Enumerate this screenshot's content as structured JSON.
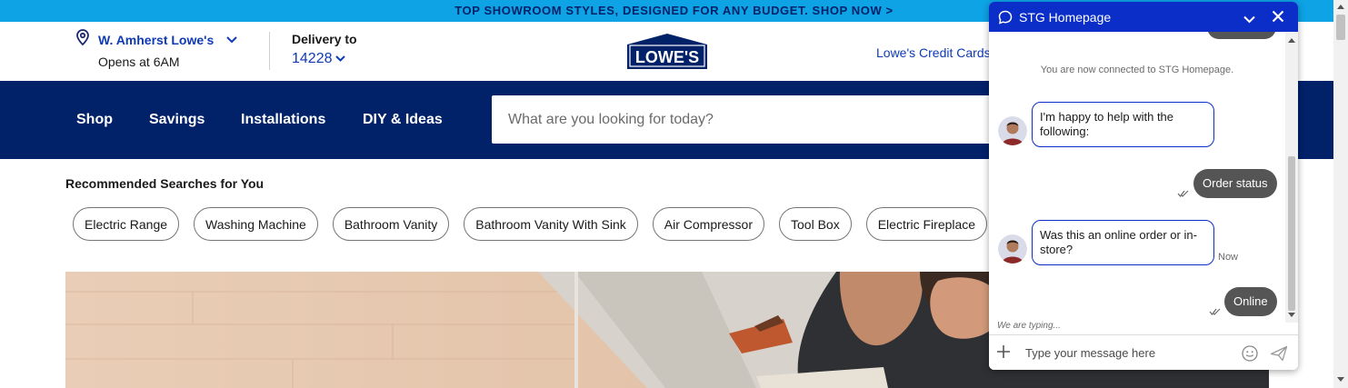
{
  "promo": {
    "text": "TOP SHOWROOM STYLES, DESIGNED FOR ANY BUDGET. SHOP NOW >"
  },
  "header": {
    "store_name": "W. Amherst Lowe's",
    "store_hours": "Opens at 6AM",
    "delivery_label": "Delivery to",
    "zip": "14228",
    "logo_text": "LOWE'S",
    "credit_link": "Lowe's Credit Cards"
  },
  "nav": {
    "items": [
      "Shop",
      "Savings",
      "Installations",
      "DIY & Ideas"
    ],
    "search_placeholder": "What are you looking for today?"
  },
  "recommended": {
    "title": "Recommended Searches for You",
    "chips": [
      "Electric Range",
      "Washing Machine",
      "Bathroom Vanity",
      "Bathroom Vanity With Sink",
      "Air Compressor",
      "Tool Box",
      "Electric Fireplace"
    ]
  },
  "chat": {
    "title": "STG Homepage",
    "system_message": "You are now connected to STG Homepage.",
    "messages": {
      "agent_1": "I'm happy to help with the following:",
      "user_1": "Order status",
      "agent_2": "Was this an online order or in-store?",
      "agent_2_time": "Now",
      "user_2": "Online"
    },
    "typing": "We are typing...",
    "input_placeholder": "Type your message here"
  },
  "colors": {
    "brand_navy": "#012169",
    "promo_blue": "#0da3e5",
    "link_blue": "#0e3ab5",
    "chat_header": "#0a2ec7",
    "user_bubble": "#555555"
  }
}
